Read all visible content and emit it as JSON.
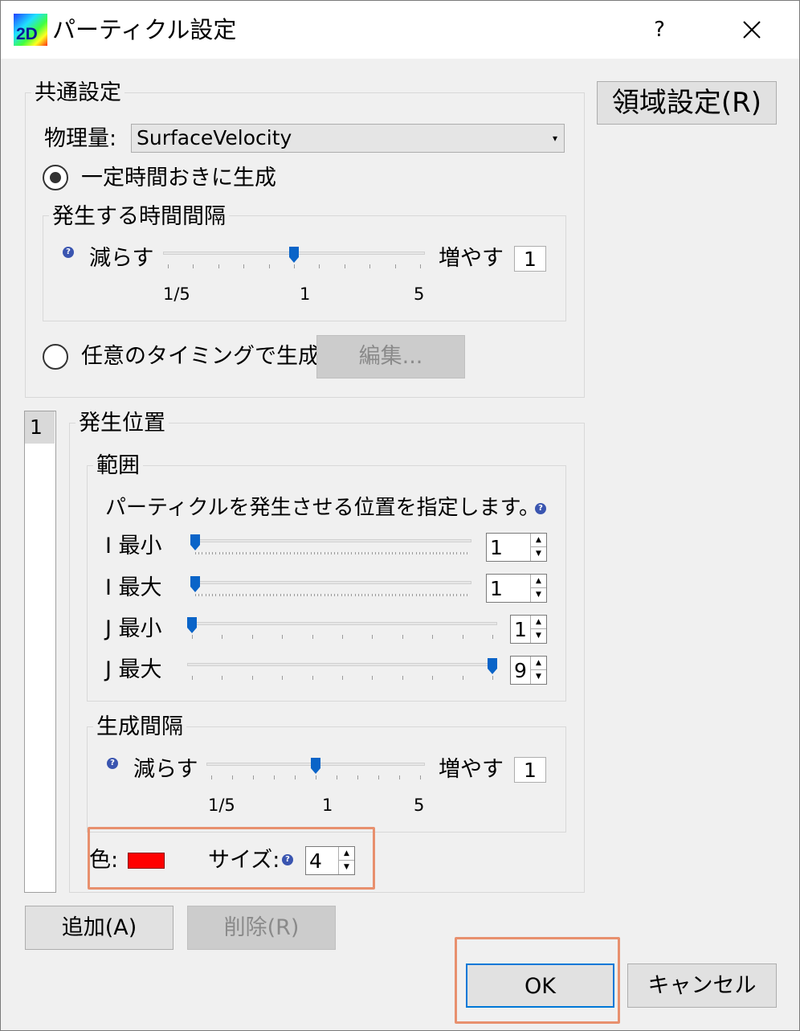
{
  "window": {
    "title": "パーティクル設定",
    "app_icon_text": "2D",
    "help_symbol": "?",
    "close_icon": "close-icon"
  },
  "common": {
    "group_label": "共通設定",
    "quantity_label": "物理量:",
    "quantity_value": "SurfaceVelocity",
    "region_button": "領域設定(R)",
    "radio_fixed_label": "一定時間おきに生成",
    "radio_fixed_selected": true,
    "interval_group_label": "発生する時間間隔",
    "interval_decrease": "減らす",
    "interval_increase": "増やす",
    "interval_value": "1",
    "interval_ticks": [
      "1/5",
      "1",
      "5"
    ],
    "interval_level": 0.5,
    "radio_arbitrary_label": "任意のタイミングで生成",
    "radio_arbitrary_selected": false,
    "edit_button": "編集..."
  },
  "list": {
    "items": [
      "1"
    ]
  },
  "position": {
    "group_label": "発生位置",
    "range_group_label": "範囲",
    "range_description": "パーティクルを発生させる位置を指定します。",
    "i_min_label": "I 最小",
    "i_min_value": "1",
    "i_min_level": 0.0,
    "i_max_label": "I 最大",
    "i_max_value": "1",
    "i_max_level": 0.0,
    "j_min_label": "J 最小",
    "j_min_value": "1",
    "j_min_level": 0.0,
    "j_max_label": "J 最大",
    "j_max_value": "9",
    "j_max_level": 1.0,
    "gen_group_label": "生成間隔",
    "gen_decrease": "減らす",
    "gen_increase": "増やす",
    "gen_value": "1",
    "gen_ticks": [
      "1/5",
      "1",
      "5"
    ],
    "gen_level": 0.5,
    "color_label": "色:",
    "color_value": "#ff0000",
    "size_label": "サイズ:",
    "size_value": "4"
  },
  "buttons": {
    "add": "追加(A)",
    "delete": "削除(R)",
    "ok": "OK",
    "cancel": "キャンセル"
  },
  "colors": {
    "thumb": "#0a64c8",
    "highlight": "#e8906e"
  }
}
